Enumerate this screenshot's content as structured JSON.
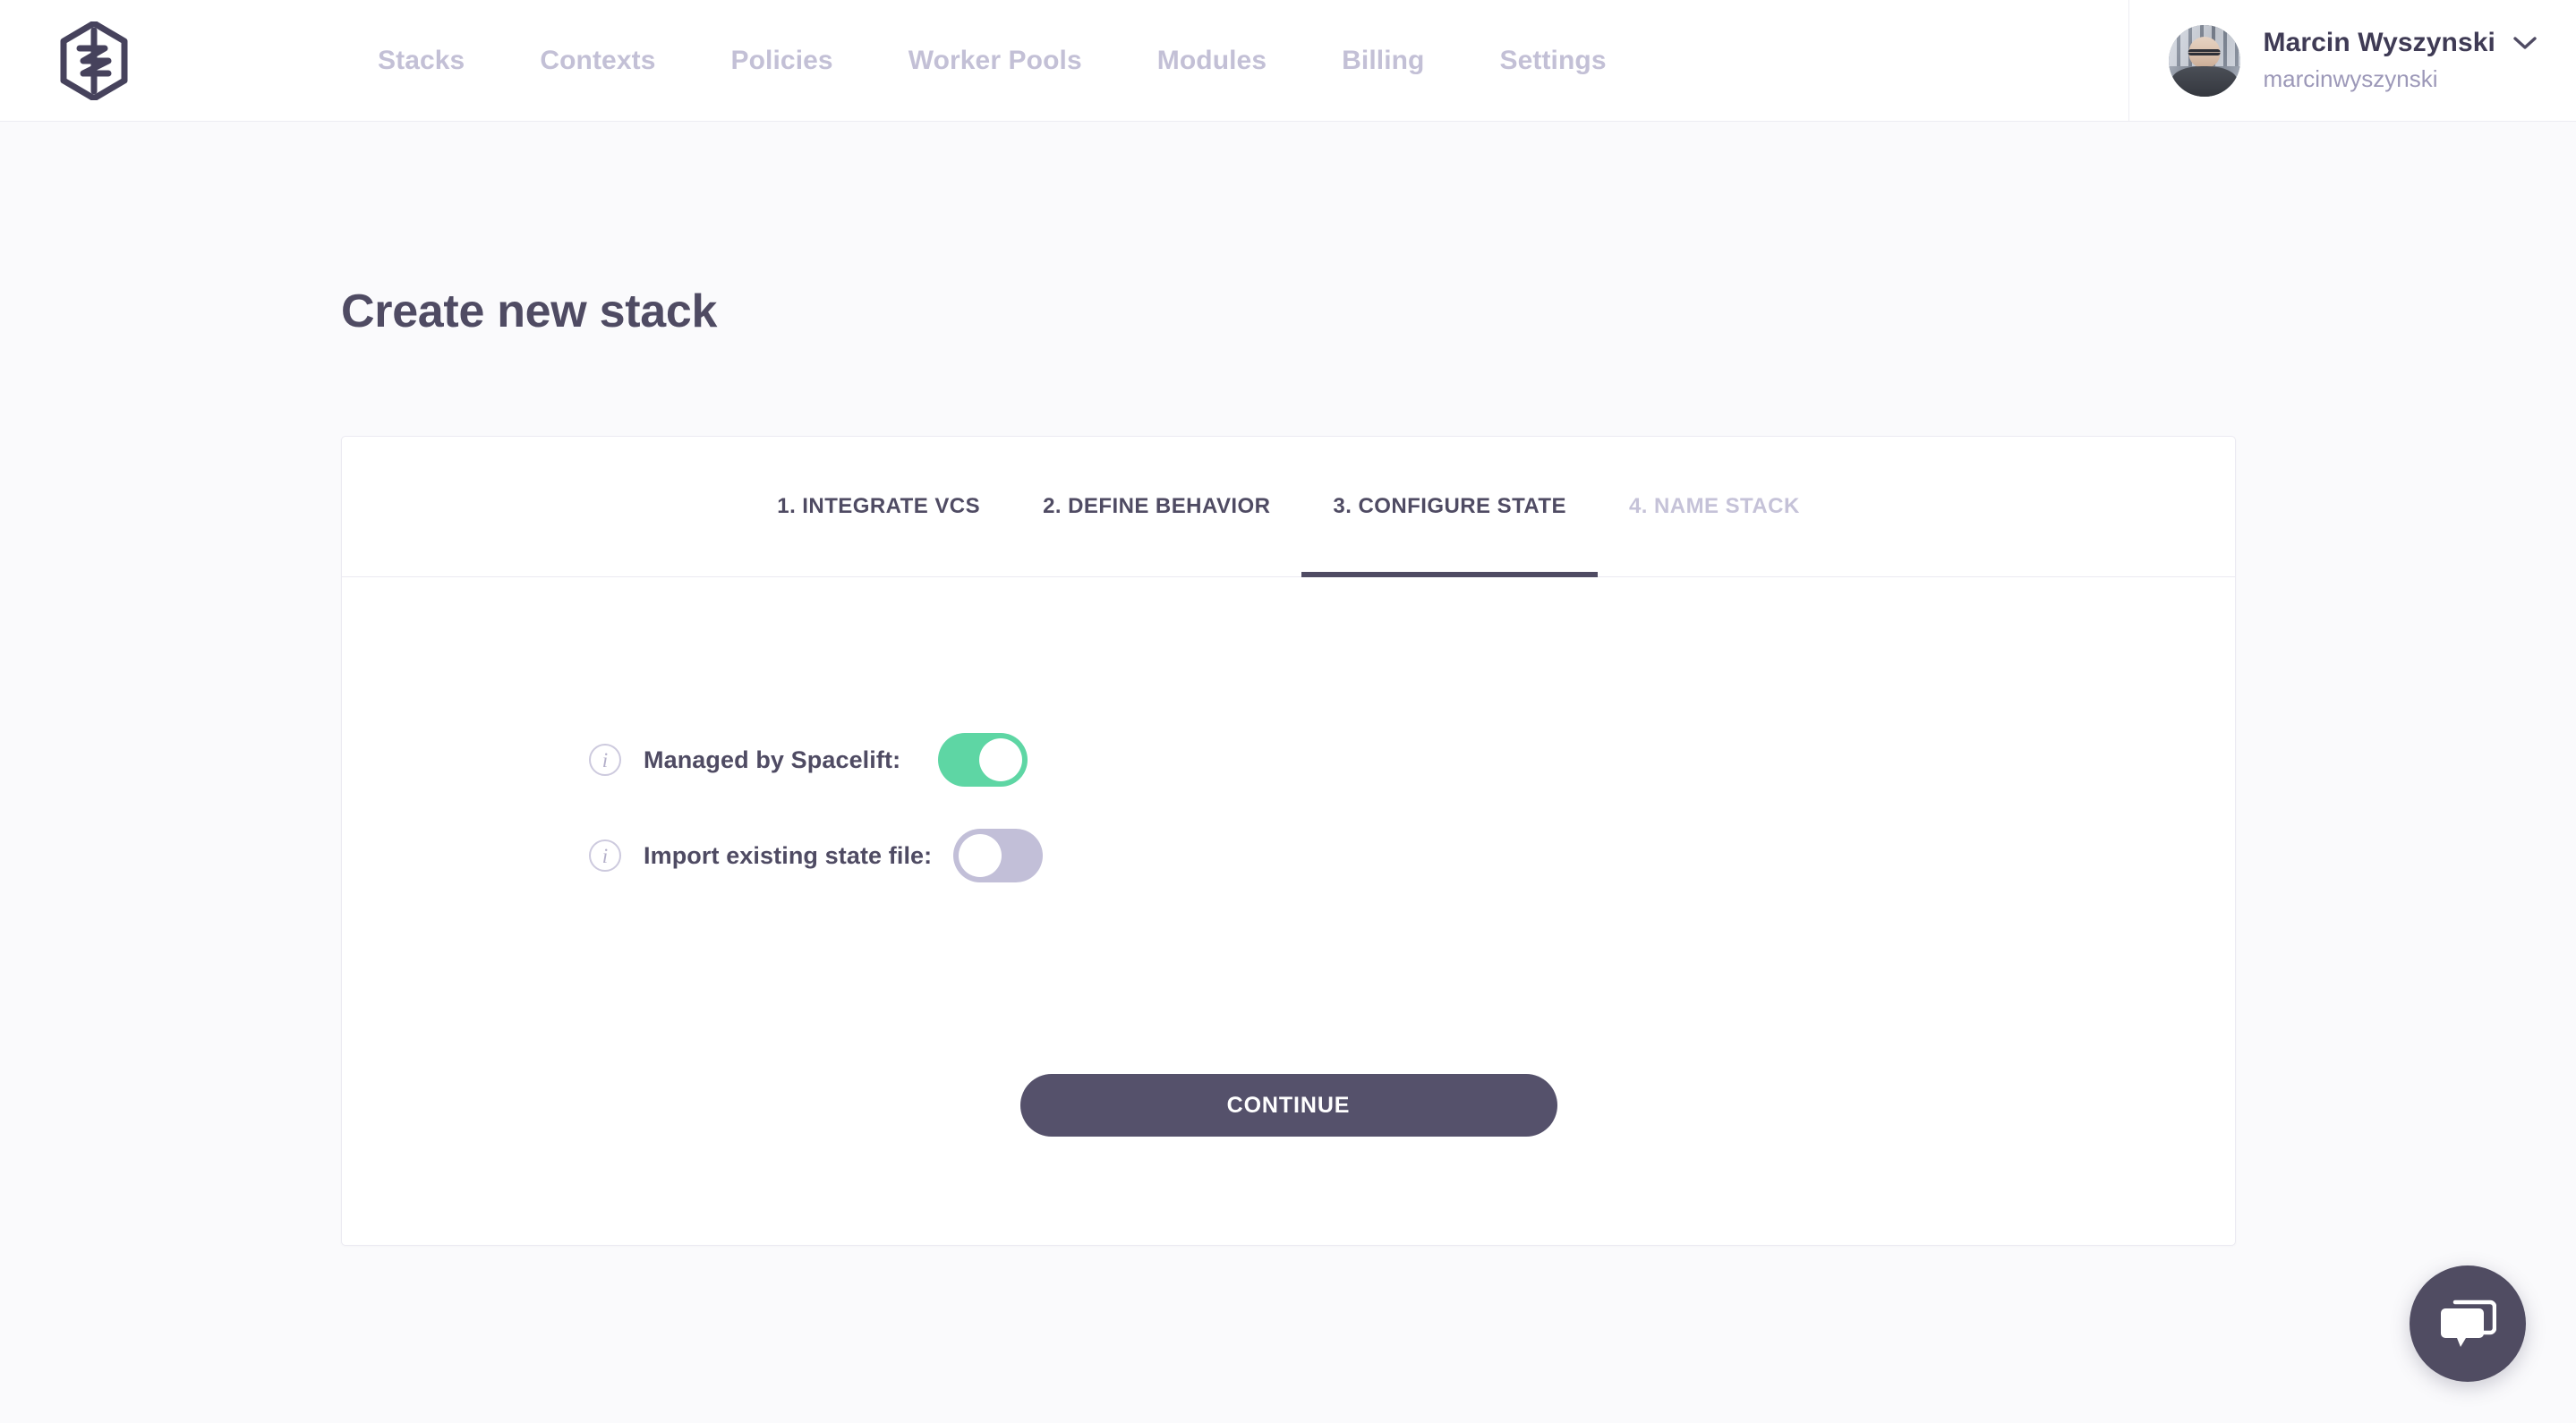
{
  "header": {
    "logo_name": "spacelift-logo",
    "nav": [
      {
        "label": "Stacks",
        "name": "nav-stacks"
      },
      {
        "label": "Contexts",
        "name": "nav-contexts"
      },
      {
        "label": "Policies",
        "name": "nav-policies"
      },
      {
        "label": "Worker Pools",
        "name": "nav-worker-pools"
      },
      {
        "label": "Modules",
        "name": "nav-modules"
      },
      {
        "label": "Billing",
        "name": "nav-billing"
      },
      {
        "label": "Settings",
        "name": "nav-settings"
      }
    ],
    "user": {
      "name": "Marcin Wyszynski",
      "login": "marcinwyszynski",
      "avatar_icon": "user-avatar-photo",
      "chevron_icon": "chevron-down-icon"
    }
  },
  "page": {
    "title": "Create new stack"
  },
  "wizard": {
    "tabs": [
      {
        "label": "1. INTEGRATE VCS",
        "state": "complete"
      },
      {
        "label": "2. DEFINE BEHAVIOR",
        "state": "complete"
      },
      {
        "label": "3. CONFIGURE STATE",
        "state": "active"
      },
      {
        "label": "4. NAME STACK",
        "state": "disabled"
      }
    ],
    "fields": [
      {
        "label": "Managed by Spacelift:",
        "info_icon": "info-icon",
        "toggle_name": "toggle-managed-by-spacelift",
        "value": "on"
      },
      {
        "label": "Import existing state file:",
        "info_icon": "info-icon",
        "toggle_name": "toggle-import-existing-state-file",
        "value": "off"
      }
    ],
    "submit_label": "CONTINUE"
  },
  "chat": {
    "icon": "chat-bubbles-icon",
    "aria_label": "Open chat"
  },
  "colors": {
    "page_background": "#fafafc",
    "surface": "#ffffff",
    "text_primary": "#4f4b63",
    "text_muted": "#c3c0d6",
    "accent_dark": "#55516b",
    "toggle_on": "#5ed6a4",
    "toggle_off": "#c2bfd8",
    "border": "#ebeaf2"
  }
}
